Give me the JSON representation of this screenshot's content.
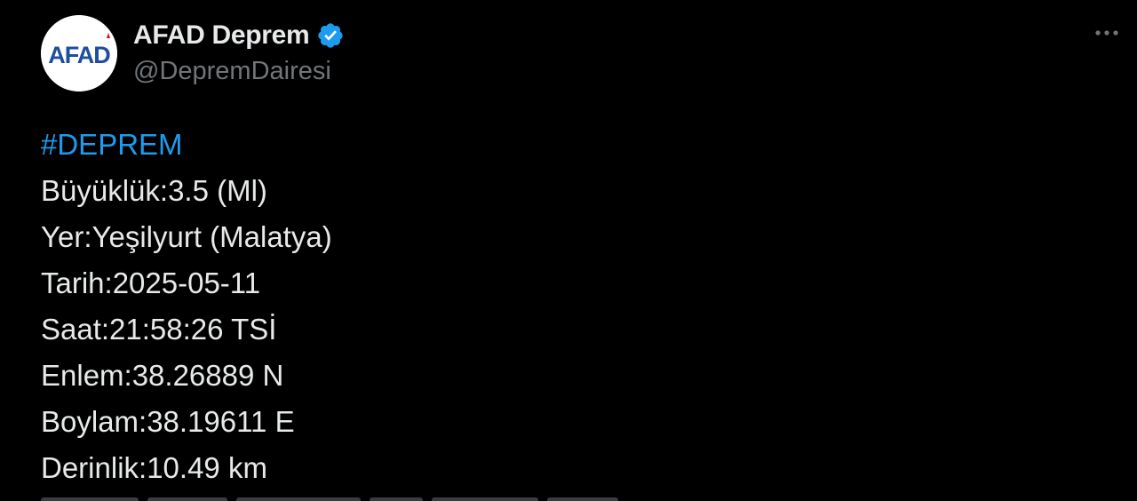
{
  "tweet": {
    "display_name": "AFAD Deprem",
    "handle": "@DepremDairesi",
    "avatar": {
      "logo_text": "AFAD",
      "icon": "afad-logo"
    },
    "verified_icon": "verified-badge-icon",
    "more_icon": "more-options-icon",
    "hashtag": "#DEPREM",
    "lines": [
      "Büyüklük:3.5 (Ml)",
      "Yer:Yeşilyurt (Malatya)",
      "Tarih:2025-05-11",
      "Saat:21:58:26 TSİ",
      "Enlem:38.26889 N",
      "Boylam:38.19611 E",
      "Derinlik:10.49 km"
    ]
  },
  "colors": {
    "background": "#000000",
    "text": "#e7e9ea",
    "secondary_text": "#71767b",
    "link": "#1d9bf0",
    "verified": "#1d9bf0",
    "logo_blue": "#1f4e9c",
    "logo_red": "#e30613"
  }
}
